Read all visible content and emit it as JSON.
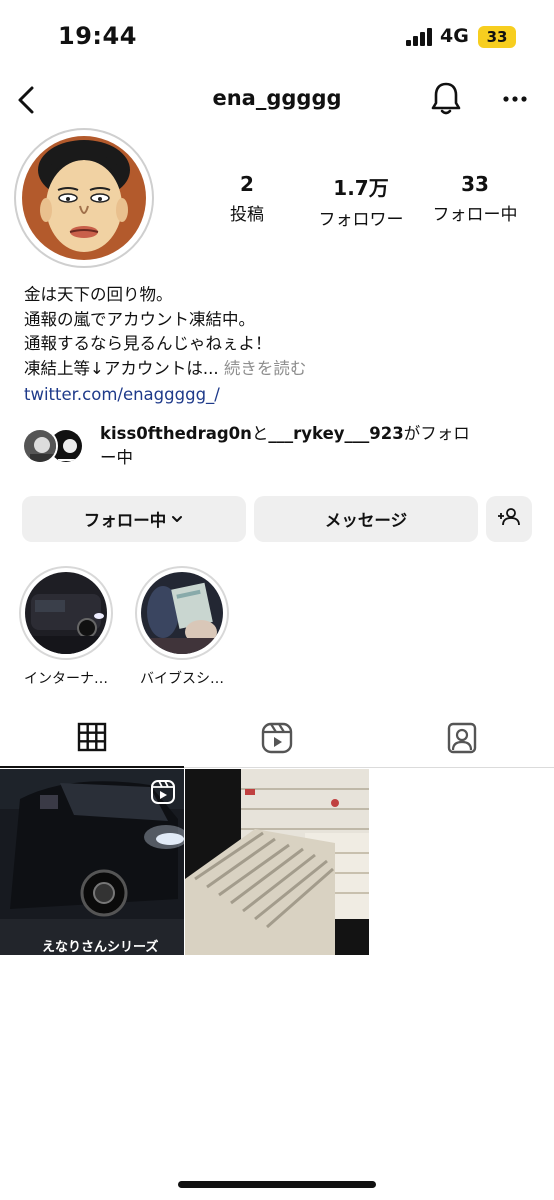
{
  "status_bar": {
    "time": "19:44",
    "network": "4G",
    "battery": "33"
  },
  "header": {
    "username": "ena_ggggg"
  },
  "stats": [
    {
      "value": "2",
      "label": "投稿"
    },
    {
      "value": "1.7万",
      "label": "フォロワー"
    },
    {
      "value": "33",
      "label": "フォロー中"
    }
  ],
  "bio": {
    "lines": [
      "金は天下の回り物。",
      "通報の嵐でアカウント凍結中。",
      "通報するなら見るんじゃねぇよ！",
      "凍結上等↓アカウントは..."
    ],
    "more": "続きを読む",
    "link": "twitter.com/enaggggg_/"
  },
  "followed_by": {
    "user1": "kiss0fthedrag0n",
    "joiner": "と",
    "user2": "___rykey___923",
    "suffix_1": "がフォロ",
    "suffix_2": "ー中"
  },
  "buttons": {
    "follow": "フォロー中",
    "message": "メッセージ"
  },
  "highlights": [
    {
      "label": "インターナ…"
    },
    {
      "label": "バイブスシ…"
    }
  ],
  "posts": [
    {
      "type": "reel",
      "caption": "えなりさんシリーズ"
    },
    {
      "type": "image"
    }
  ],
  "colors": {
    "link": "#1e3a8a",
    "button_bg": "#efefef",
    "battery": "#f7ce1f"
  }
}
